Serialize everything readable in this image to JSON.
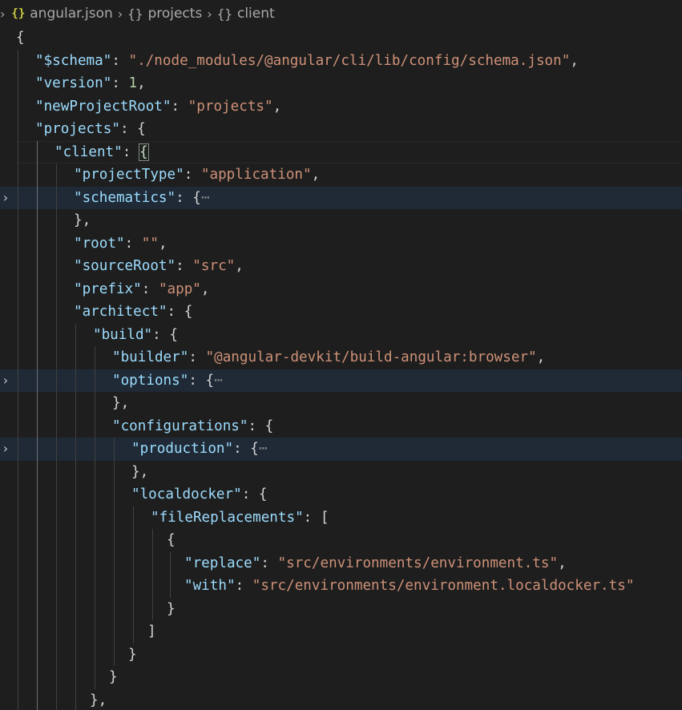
{
  "breadcrumb": {
    "file_icon": "{}",
    "file": "angular.json",
    "seg1_icon": "{}",
    "seg1": "projects",
    "seg2_icon": "{}",
    "seg2": "client"
  },
  "code": {
    "l1": {
      "p1": "{"
    },
    "l2": {
      "key": "\"$schema\"",
      "sep": ": ",
      "val": "\"./node_modules/@angular/cli/lib/config/schema.json\"",
      "end": ","
    },
    "l3": {
      "key": "\"version\"",
      "sep": ": ",
      "val": "1",
      "end": ","
    },
    "l4": {
      "key": "\"newProjectRoot\"",
      "sep": ": ",
      "val": "\"projects\"",
      "end": ","
    },
    "l5": {
      "key": "\"projects\"",
      "sep": ": ",
      "end": "{"
    },
    "l6": {
      "key": "\"client\"",
      "sep": ": ",
      "end": "{"
    },
    "l7": {
      "key": "\"projectType\"",
      "sep": ": ",
      "val": "\"application\"",
      "end": ","
    },
    "l8": {
      "key": "\"schematics\"",
      "sep": ": ",
      "end": "{",
      "ell": "⋯"
    },
    "l9": {
      "p1": "},"
    },
    "l10": {
      "key": "\"root\"",
      "sep": ": ",
      "val": "\"\"",
      "end": ","
    },
    "l11": {
      "key": "\"sourceRoot\"",
      "sep": ": ",
      "val": "\"src\"",
      "end": ","
    },
    "l12": {
      "key": "\"prefix\"",
      "sep": ": ",
      "val": "\"app\"",
      "end": ","
    },
    "l13": {
      "key": "\"architect\"",
      "sep": ": ",
      "end": "{"
    },
    "l14": {
      "key": "\"build\"",
      "sep": ": ",
      "end": "{"
    },
    "l15": {
      "key": "\"builder\"",
      "sep": ": ",
      "val": "\"@angular-devkit/build-angular:browser\"",
      "end": ","
    },
    "l16": {
      "key": "\"options\"",
      "sep": ": ",
      "end": "{",
      "ell": "⋯"
    },
    "l17": {
      "p1": "},"
    },
    "l18": {
      "key": "\"configurations\"",
      "sep": ": ",
      "end": "{"
    },
    "l19": {
      "key": "\"production\"",
      "sep": ": ",
      "end": "{",
      "ell": "⋯"
    },
    "l20": {
      "p1": "},"
    },
    "l21": {
      "key": "\"localdocker\"",
      "sep": ": ",
      "end": "{"
    },
    "l22": {
      "key": "\"fileReplacements\"",
      "sep": ": ",
      "end": "["
    },
    "l23": {
      "p1": "{"
    },
    "l24": {
      "key": "\"replace\"",
      "sep": ": ",
      "val": "\"src/environments/environment.ts\"",
      "end": ","
    },
    "l25": {
      "key": "\"with\"",
      "sep": ": ",
      "val": "\"src/environments/environment.localdocker.ts\""
    },
    "l26": {
      "p1": "}"
    },
    "l27": {
      "p1": "]"
    },
    "l28": {
      "p1": "}"
    },
    "l29": {
      "p1": "}"
    },
    "l30": {
      "p1": "},"
    }
  },
  "colors": {
    "background": "#1e1e1e",
    "key": "#9cdcfe",
    "string": "#ce9178",
    "number": "#b5cea8",
    "punctuation": "#d4d4d4",
    "folded_highlight": "#1f2a36"
  },
  "icons": {
    "fold": "chevron-right-icon",
    "json_file": "json-file-icon",
    "symbol": "object-symbol-icon"
  }
}
